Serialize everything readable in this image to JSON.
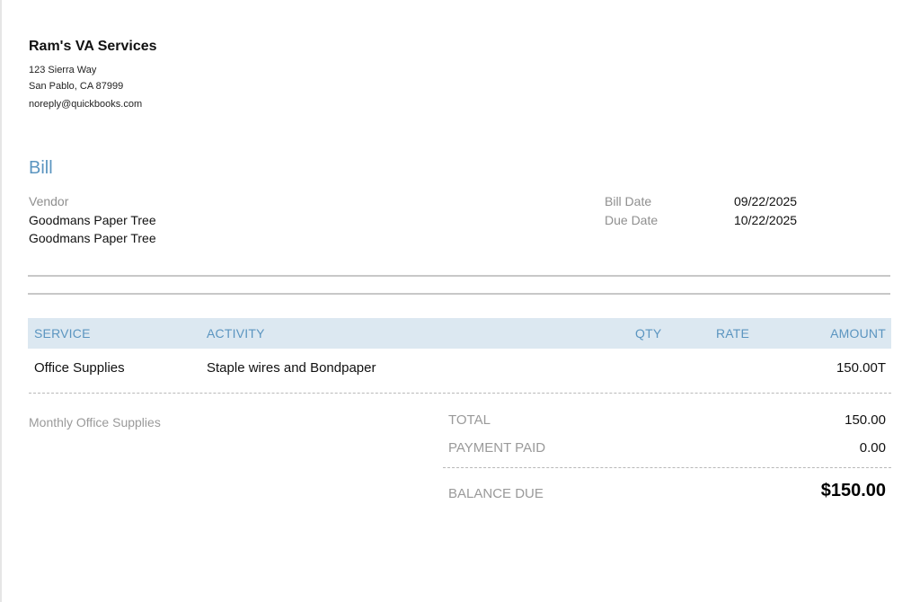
{
  "company": {
    "name": "Ram's VA Services",
    "address_line1": "123 Sierra Way",
    "address_line2": "San Pablo, CA  87999",
    "email": "noreply@quickbooks.com"
  },
  "document": {
    "title": "Bill"
  },
  "vendor": {
    "label": "Vendor",
    "line1": "Goodmans Paper Tree",
    "line2": "Goodmans Paper Tree"
  },
  "dates": {
    "bill_date_label": "Bill Date",
    "bill_date_value": "09/22/2025",
    "due_date_label": "Due Date",
    "due_date_value": "10/22/2025"
  },
  "table": {
    "headers": {
      "service": "SERVICE",
      "activity": "ACTIVITY",
      "qty": "QTY",
      "rate": "RATE",
      "amount": "AMOUNT"
    },
    "rows": [
      {
        "service": "Office Supplies",
        "activity": "Staple wires and Bondpaper",
        "qty": "",
        "rate": "",
        "amount": "150.00T"
      }
    ]
  },
  "memo": "Monthly Office Supplies",
  "summary": {
    "total_label": "TOTAL",
    "total_value": "150.00",
    "paid_label": "PAYMENT PAID",
    "paid_value": "0.00",
    "balance_label": "BALANCE DUE",
    "balance_value": "$150.00"
  },
  "colors": {
    "accent": "#5b95c0",
    "header_bg": "#dce8f1",
    "muted_text": "#9a9a9a"
  }
}
